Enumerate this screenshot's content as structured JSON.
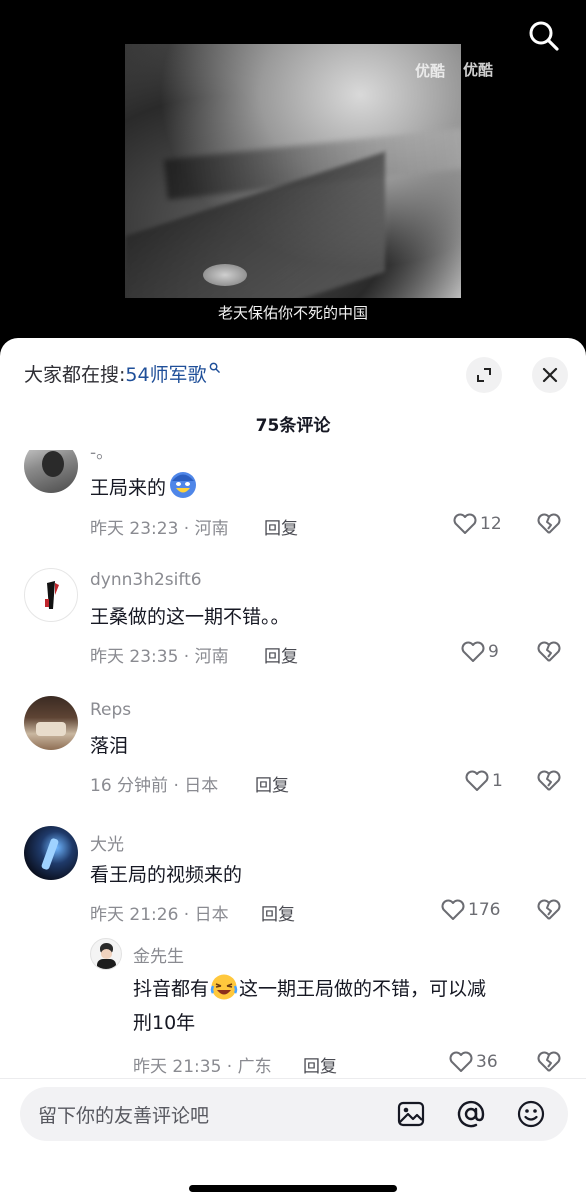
{
  "video": {
    "watermark_1": "优酷",
    "watermark_2": "优酷",
    "subtitle": "老天保佑你不死的中国"
  },
  "sheet": {
    "search_prefix": "大家都在搜:",
    "search_keyword": "54师军歌",
    "comment_count": "75条评论"
  },
  "comments": [
    {
      "username": "-。",
      "text": "王局来的",
      "emoji": "blue-laughing-emoji",
      "time": "昨天 23:23 · 河南",
      "reply_label": "回复",
      "likes": "12"
    },
    {
      "username": "dynn3h2sift6",
      "text": "王桑做的这一期不错。。",
      "time": "昨天 23:35 · 河南",
      "reply_label": "回复",
      "likes": "9"
    },
    {
      "username": "Reps",
      "text": "落泪",
      "time": "16 分钟前 · 日本",
      "reply_label": "回复",
      "likes": "1"
    },
    {
      "username": "大光",
      "text": "看王局的视频来的",
      "time": "昨天 21:26 · 日本",
      "reply_label": "回复",
      "likes": "176"
    }
  ],
  "reply": {
    "username": "金先生",
    "text_before": "抖音都有",
    "emoji": "rolling-laughing-emoji",
    "text_after": "这一期王局做的不错，可以减",
    "text_line2": "刑10年",
    "time": "昨天 21:35 · 广东",
    "reply_label": "回复",
    "likes": "36"
  },
  "input": {
    "placeholder": "留下你的友善评论吧"
  },
  "colors": {
    "search_keyword": "#1f4f99",
    "sheet_bg": "#ffffff",
    "input_bg": "#f2f2f4",
    "meta_gray": "#8a8b91"
  }
}
